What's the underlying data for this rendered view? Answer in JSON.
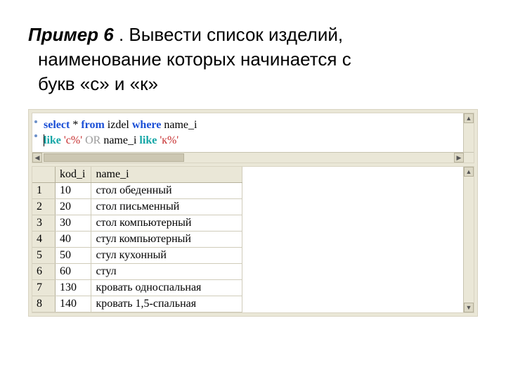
{
  "heading": {
    "prefix": "Пример 6",
    "sep": " . ",
    "line1_rest": "Вывести список изделий,",
    "line2": "наименование которых начинается с",
    "line3": "букв «с» и «к»"
  },
  "sql": {
    "line1": {
      "select": "select",
      "star": " * ",
      "from": "from",
      "table": " izdel ",
      "where": "where",
      "col": " name_i"
    },
    "line2": {
      "like1": "like",
      "lit1": " 'с%' ",
      "or": "OR",
      "col": " name_i ",
      "like2": "like",
      "lit2": " 'к%'"
    }
  },
  "grid": {
    "columns": [
      "kod_i",
      "name_i"
    ],
    "rows": [
      {
        "n": "1",
        "kod_i": "10",
        "name_i": "стол обеденный"
      },
      {
        "n": "2",
        "kod_i": "20",
        "name_i": "стол письменный"
      },
      {
        "n": "3",
        "kod_i": "30",
        "name_i": "стол компьютерный"
      },
      {
        "n": "4",
        "kod_i": "40",
        "name_i": "стул компьютерный"
      },
      {
        "n": "5",
        "kod_i": "50",
        "name_i": "стул кухонный"
      },
      {
        "n": "6",
        "kod_i": "60",
        "name_i": "стул"
      },
      {
        "n": "7",
        "kod_i": "130",
        "name_i": "кровать односпальная"
      },
      {
        "n": "8",
        "kod_i": "140",
        "name_i": "кровать 1,5-спальная"
      }
    ]
  },
  "glyphs": {
    "up": "▲",
    "down": "▼",
    "left": "◀",
    "right": "▶"
  }
}
